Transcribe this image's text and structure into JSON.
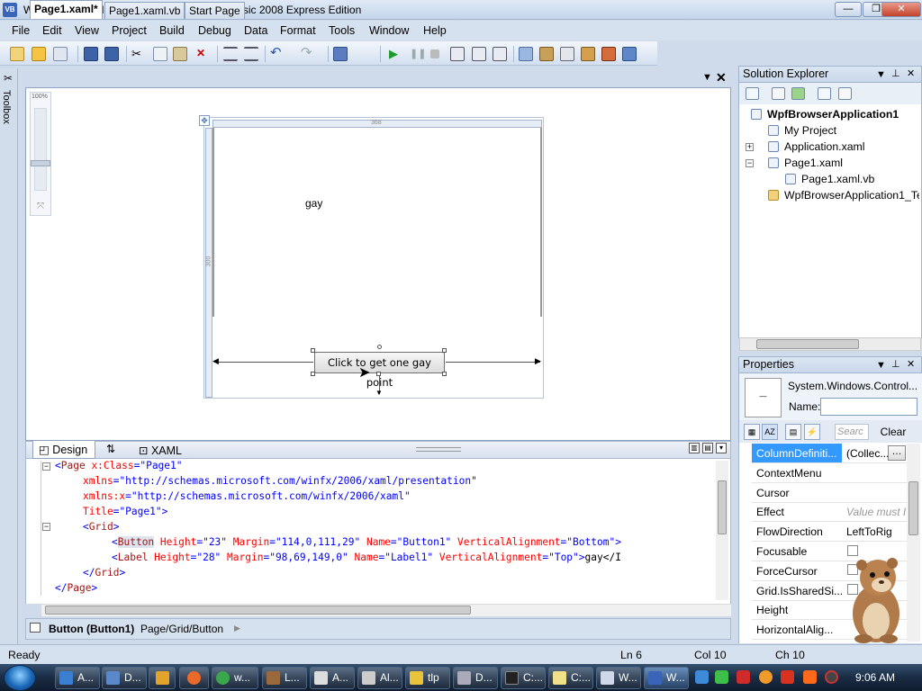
{
  "window": {
    "title": "WpfBrowserApplication1 - Microsoft Visual Basic 2008 Express Edition",
    "icon": "VB"
  },
  "menu": [
    "File",
    "Edit",
    "View",
    "Project",
    "Build",
    "Debug",
    "Data",
    "Format",
    "Tools",
    "Window",
    "Help"
  ],
  "toolbox": {
    "label": "Toolbox"
  },
  "tabs": [
    "Page1.xaml*",
    "Page1.xaml.vb",
    "Start Page"
  ],
  "designer": {
    "zoom": "100%",
    "ruler_top": "368",
    "ruler_left": "300",
    "label_text": "gay",
    "button_text": "Click to get one gay point"
  },
  "split": {
    "design_tab": "Design",
    "swap": "⇅",
    "xaml_tab": "XAML"
  },
  "code": {
    "line1": {
      "open": "<",
      "tag": "Page",
      "attr": " x:Class",
      "eq": "=",
      "val": "\"Page1\""
    },
    "line2": {
      "attr": "xmlns",
      "eq": "=",
      "val": "\"http://schemas.microsoft.com/winfx/2006/xaml/presentation\""
    },
    "line3": {
      "attr": "xmlns:x",
      "eq": "=",
      "val": "\"http://schemas.microsoft.com/winfx/2006/xaml\""
    },
    "line4": {
      "attr": "Title",
      "eq": "=",
      "val": "\"Page1\"",
      "close": ">"
    },
    "line5": {
      "open": "<",
      "tag": "Grid",
      "close": ">"
    },
    "line6": {
      "open": "<",
      "tag": "Button",
      "a1": " Height",
      "v1": "\"23\"",
      "a2": " Margin",
      "v2": "\"114,0,111,29\"",
      "a3": " Name",
      "v3": "\"Button1\"",
      "a4": " VerticalAlignment",
      "v4": "\"Bottom\"",
      "tail": ">"
    },
    "line7": {
      "open": "<",
      "tag": "Label",
      "a1": " Height",
      "v1": "\"28\"",
      "a2": " Margin",
      "v2": "\"98,69,149,0\"",
      "a3": " Name",
      "v3": "\"Label1\"",
      "a4": " VerticalAlignment",
      "v4": "\"Top\"",
      "tail": ">",
      "text": "gay</I"
    },
    "line8": {
      "open": "</",
      "tag": "Grid",
      "close": ">"
    },
    "line9": {
      "open": "</",
      "tag": "Page",
      "close": ">"
    }
  },
  "pathbar": {
    "bold": "Button (Button1)",
    "rest": "Page/Grid/Button"
  },
  "solution_explorer": {
    "title": "Solution Explorer",
    "items": [
      "WpfBrowserApplication1",
      "My Project",
      "Application.xaml",
      "Page1.xaml",
      "Page1.xaml.vb",
      "WpfBrowserApplication1_Te"
    ]
  },
  "properties": {
    "title": "Properties",
    "type": "System.Windows.Control...",
    "name_label": "Name:",
    "name_value": "",
    "search_placeholder": "Searc",
    "clear": "Clear",
    "rows": [
      {
        "name": "ColumnDefiniti...",
        "value": "(Collec..."
      },
      {
        "name": "ContextMenu",
        "value": ""
      },
      {
        "name": "Cursor",
        "value": ""
      },
      {
        "name": "Effect",
        "value": "Value must I"
      },
      {
        "name": "FlowDirection",
        "value": "LeftToRig"
      },
      {
        "name": "Focusable",
        "value": ""
      },
      {
        "name": "ForceCursor",
        "value": ""
      },
      {
        "name": "Grid.IsSharedSi...",
        "value": ""
      },
      {
        "name": "Height",
        "value": ""
      },
      {
        "name": "HorizontalAlig...",
        "value": ""
      }
    ]
  },
  "status": {
    "ready": "Ready",
    "ln": "Ln 6",
    "col": "Col 10",
    "ch": "Ch 10"
  },
  "taskbar": {
    "items": [
      "A...",
      "D...",
      "",
      "",
      "w...",
      "L...",
      "A...",
      "Al...",
      "tlp",
      "D...",
      "C:...",
      "C:...",
      "W...",
      "W..."
    ],
    "clock": "9:06 AM"
  },
  "colors": {
    "accent": "#3399ff",
    "chrome": "#cfdaea"
  }
}
